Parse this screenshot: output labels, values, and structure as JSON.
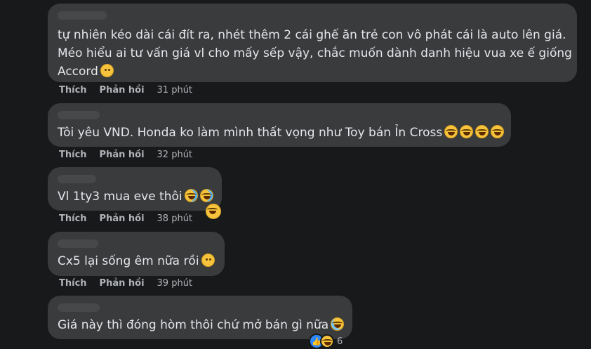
{
  "comments": [
    {
      "lines": [
        "tự nhiên kéo dài cái đít ra, nhét thêm 2 cái ghế ăn trẻ con vô phát cái là auto lên giá.",
        "Méo hiểu ai tư vấn giá vl cho mấy sếp vậy, chắc muốn dành danh hiệu vua xe ế giống",
        "Accord"
      ],
      "emojis": [
        "smiling-face"
      ],
      "like_label": "Thích",
      "reply_label": "Phản hồi",
      "time": "31 phút"
    },
    {
      "lines": [
        "Tôi yêu VND. Honda ko làm mình thất vọng như Toy bán Ỉn Cross"
      ],
      "emojis": [
        "joy",
        "joy",
        "joy",
        "joy"
      ],
      "like_label": "Thích",
      "reply_label": "Phản hồi",
      "time": "32 phút"
    },
    {
      "lines": [
        "Vl 1ty3 mua eve thôi"
      ],
      "emojis": [
        "rofl",
        "rofl"
      ],
      "like_label": "Thích",
      "reply_label": "Phản hồi",
      "time": "38 phút"
    },
    {
      "lines": [
        "Cx5 lại sống êm nữa rồi"
      ],
      "emojis": [
        "grinning-smiling-eyes"
      ],
      "like_label": "Thích",
      "reply_label": "Phản hồi",
      "time": "39 phút"
    },
    {
      "lines": [
        "Giá này thì đóng hòm thôi chứ mở bán gì nữa"
      ],
      "emojis": [
        "grinning-sweat"
      ],
      "reaction_count": "6"
    }
  ],
  "colors": {
    "background": "#18191a",
    "bubble": "#3a3b3c",
    "text": "#e4e6eb",
    "secondary": "#b0b3b8",
    "like_blue": "#2d88ff"
  }
}
